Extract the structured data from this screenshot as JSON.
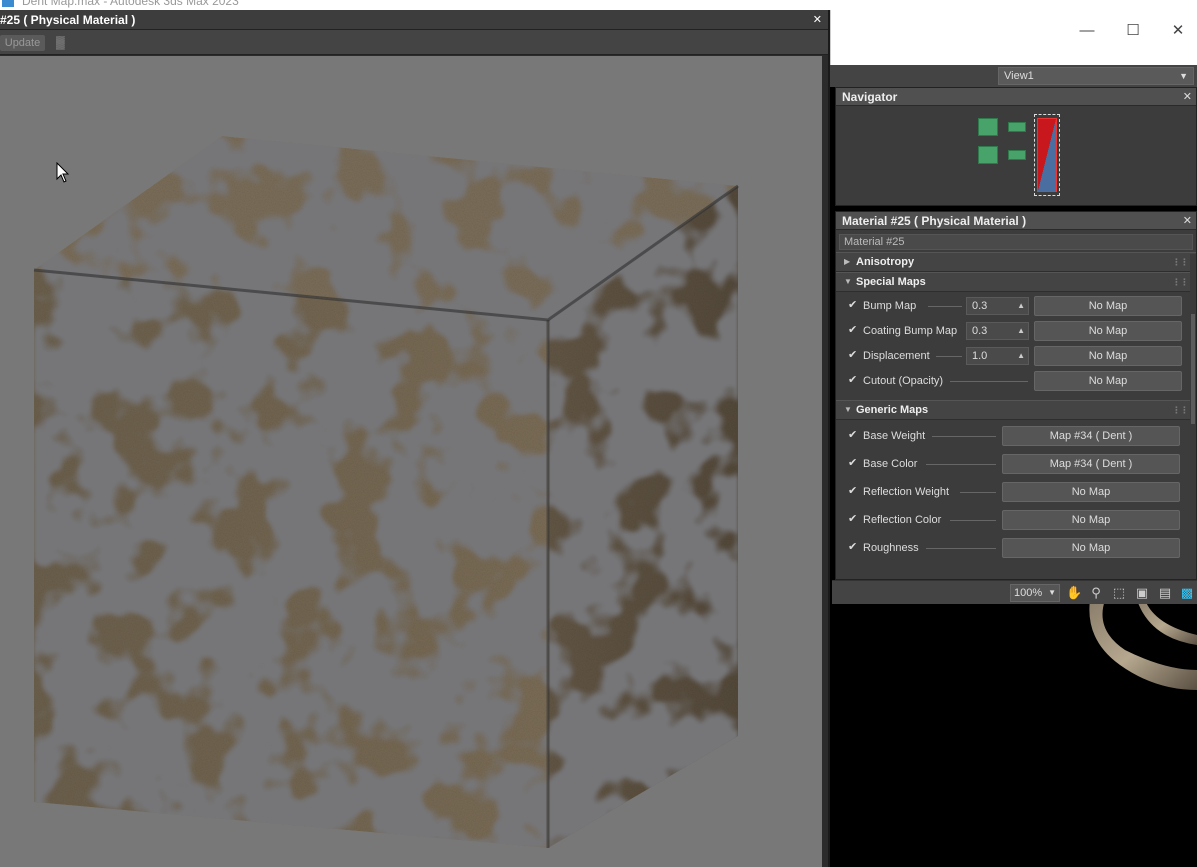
{
  "app_title": "Dent Map.max - Autodesk 3ds Max 2023",
  "preview_window": {
    "title": "#25  ( Physical Material )",
    "update_button": "Update"
  },
  "view_select": "View1",
  "navigator": {
    "title": "Navigator"
  },
  "material_panel": {
    "title": "Material #25  ( Physical Material )",
    "name_field": "Material #25",
    "rollout_anisotropy": "Anisotropy",
    "rollout_special_maps": "Special Maps",
    "special_maps": [
      {
        "label": "Bump Map",
        "value": "0.3",
        "map": "No Map",
        "checked": true
      },
      {
        "label": "Coating Bump Map",
        "value": "0.3",
        "map": "No Map",
        "checked": true
      },
      {
        "label": "Displacement",
        "value": "1.0",
        "map": "No Map",
        "checked": true
      },
      {
        "label": "Cutout (Opacity)",
        "value": "",
        "map": "No Map",
        "checked": true
      }
    ],
    "rollout_generic_maps": "Generic Maps",
    "generic_maps": [
      {
        "label": "Base Weight",
        "map": "Map #34  ( Dent )",
        "checked": true
      },
      {
        "label": "Base Color",
        "map": "Map #34  ( Dent )",
        "checked": true
      },
      {
        "label": "Reflection Weight",
        "map": "No Map",
        "checked": true
      },
      {
        "label": "Reflection Color",
        "map": "No Map",
        "checked": true
      },
      {
        "label": "Roughness",
        "map": "No Map",
        "checked": true
      }
    ]
  },
  "zoom": "100%",
  "icons": [
    "hand-pan-icon",
    "zoom-icon",
    "zoom-region-icon",
    "frame-icon",
    "fit-icon",
    "highlight-icon"
  ]
}
